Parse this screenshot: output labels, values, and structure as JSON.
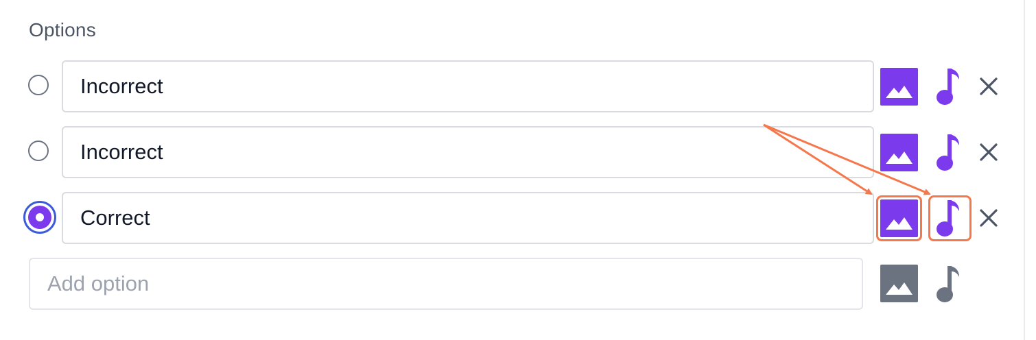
{
  "section": {
    "label": "Options"
  },
  "options": [
    {
      "text": "Incorrect",
      "checked": false
    },
    {
      "text": "Incorrect",
      "checked": false
    },
    {
      "text": "Correct",
      "checked": true
    }
  ],
  "add_option": {
    "placeholder": "Add option"
  },
  "icons": {
    "image": "image-icon",
    "audio": "music-note-icon",
    "remove": "close-icon"
  },
  "colors": {
    "accent": "#7c3aed",
    "radio_ring": "#3b5bdb",
    "disabled_icon": "#6b7280",
    "annotation": "#f4784b"
  }
}
